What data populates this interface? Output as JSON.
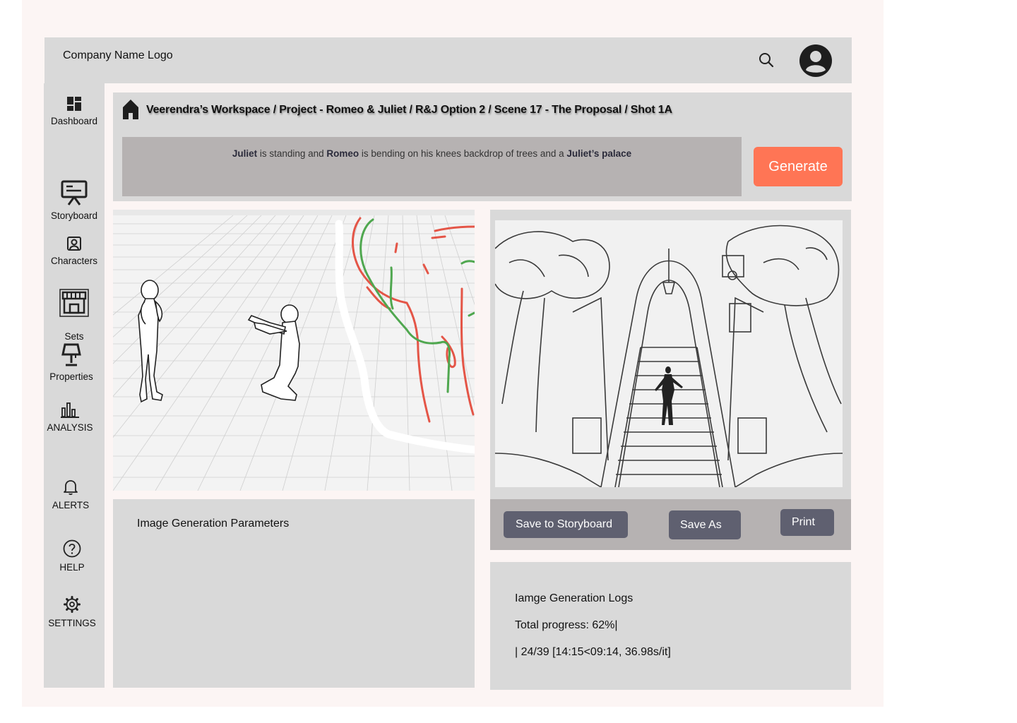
{
  "header": {
    "logo": "Company Name Logo",
    "search_icon": "search-icon",
    "avatar_icon": "user-avatar-icon"
  },
  "sidebar": {
    "items": [
      {
        "label": "Dashboard",
        "icon": "dashboard-icon"
      },
      {
        "label": "Storyboard",
        "icon": "presentation-board-icon"
      },
      {
        "label": "Characters",
        "icon": "portrait-icon"
      },
      {
        "label": "Sets",
        "icon": "storefront-icon"
      },
      {
        "label": "Properties",
        "icon": "lamp-icon"
      },
      {
        "label": "ANALYSIS",
        "icon": "bar-chart-icon"
      },
      {
        "label": "ALERTS",
        "icon": "bell-icon"
      },
      {
        "label": "HELP",
        "icon": "help-circle-icon"
      },
      {
        "label": "SETTINGS",
        "icon": "gear-icon"
      }
    ]
  },
  "breadcrumb": "Veerendra’s Workspace / Project - Romeo & Juliet / R&J Option 2 / Scene 17 - The Proposal / Shot 1A",
  "prompt": {
    "juliet": "Juliet",
    "t1": " is standing and ",
    "romeo": "Romeo",
    "t2": " is bending on his knees backdrop of trees and a ",
    "palace": "Juliet’s palace"
  },
  "generate_label": "Generate",
  "actions": {
    "save_storyboard": "Save  to Storyboard",
    "save_as": "Save As",
    "print": "Print"
  },
  "params_title": "Image Generation Parameters",
  "logs": {
    "title": "Iamge Generation Logs",
    "progress": "Total progress:  62%|",
    "detail": "| 24/39 [14:15<09:14, 36.98s/it]"
  },
  "colors": {
    "accent": "#ff7555",
    "panel": "#d9d9d9",
    "action_button": "#5f6070"
  }
}
